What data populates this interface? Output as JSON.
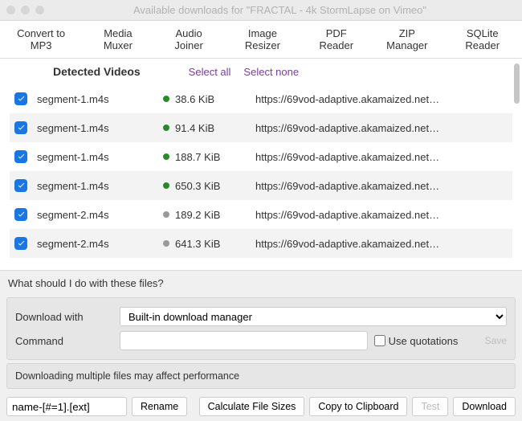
{
  "window": {
    "title": "Available downloads for \"FRACTAL - 4k StormLapse on Vimeo\""
  },
  "toolbar": {
    "items": [
      "Convert to MP3",
      "Media Muxer",
      "Audio Joiner",
      "Image Resizer",
      "PDF Reader",
      "ZIP Manager",
      "SQLite Reader"
    ]
  },
  "list": {
    "header": "Detected Videos",
    "select_all": "Select all",
    "select_none": "Select none",
    "rows": [
      {
        "name": "segment-1.m4s",
        "size": "38.6 KiB",
        "status": "green",
        "url": "https://69vod-adaptive.akamaized.net…"
      },
      {
        "name": "segment-1.m4s",
        "size": "91.4 KiB",
        "status": "green",
        "url": "https://69vod-adaptive.akamaized.net…"
      },
      {
        "name": "segment-1.m4s",
        "size": "188.7 KiB",
        "status": "green",
        "url": "https://69vod-adaptive.akamaized.net…"
      },
      {
        "name": "segment-1.m4s",
        "size": "650.3 KiB",
        "status": "green",
        "url": "https://69vod-adaptive.akamaized.net…"
      },
      {
        "name": "segment-2.m4s",
        "size": "189.2 KiB",
        "status": "gray",
        "url": "https://69vod-adaptive.akamaized.net…"
      },
      {
        "name": "segment-2.m4s",
        "size": "641.3 KiB",
        "status": "gray",
        "url": "https://69vod-adaptive.akamaized.net…"
      }
    ]
  },
  "prompt": "What should I do with these files?",
  "download": {
    "label": "Download with",
    "value": "Built-in download manager",
    "command_label": "Command",
    "use_quotations": "Use quotations",
    "save": "Save"
  },
  "warning": "Downloading multiple files may affect performance",
  "bottom": {
    "pattern": "name-[#=1].[ext]",
    "rename": "Rename",
    "calc": "Calculate File Sizes",
    "copy": "Copy to Clipboard",
    "test": "Test",
    "download": "Download"
  }
}
